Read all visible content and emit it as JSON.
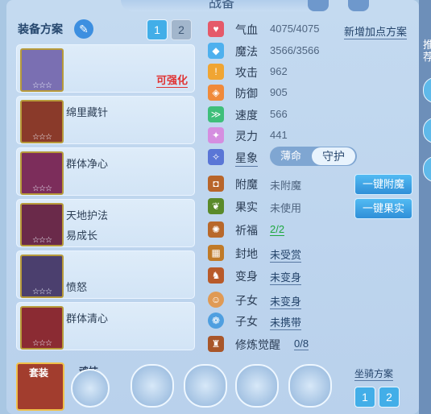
{
  "window": {
    "title": "战备"
  },
  "right_edge": {
    "text": "推荐"
  },
  "equip": {
    "label": "装备方案",
    "tabs": [
      "1",
      "2"
    ],
    "slots": [
      {
        "name": "",
        "stars": "☆☆☆",
        "tag": "可强化"
      },
      {
        "name": "绵里藏针",
        "stars": "☆☆☆"
      },
      {
        "name": "群体净心",
        "stars": "☆☆☆"
      },
      {
        "name": "天地护法",
        "sub": "易成长",
        "stars": "☆☆☆"
      },
      {
        "name": "愤怒",
        "stars": "☆☆☆"
      },
      {
        "name": "群体清心",
        "stars": "☆☆☆"
      }
    ]
  },
  "stats": {
    "add_scheme": "新增加点方案",
    "rows": [
      {
        "name": "气血",
        "value": "4075/4075"
      },
      {
        "name": "魔法",
        "value": "3566/3566"
      },
      {
        "name": "攻击",
        "value": "962"
      },
      {
        "name": "防御",
        "value": "905"
      },
      {
        "name": "速度",
        "value": "566"
      },
      {
        "name": "灵力",
        "value": "441"
      }
    ],
    "star_label": "星象",
    "star_options": [
      "薄命",
      "守护"
    ]
  },
  "extras": {
    "rows": [
      {
        "name": "附魔",
        "value": "未附魔"
      },
      {
        "name": "果实",
        "value": "未使用"
      },
      {
        "name": "祈福",
        "value": "2/2"
      },
      {
        "name": "封地",
        "value": "未受赏"
      },
      {
        "name": "变身",
        "value": "未变身"
      },
      {
        "name": "子女",
        "value": "未变身"
      },
      {
        "name": "子女",
        "value": "未携带"
      },
      {
        "name": "修炼觉醒",
        "value": "0/8"
      }
    ],
    "btn_enchant": "一键附魔",
    "btn_fruit": "一键果实"
  },
  "bottom": {
    "suit_label": "套装",
    "soul_label": "魂技",
    "mount_label": "坐骑方案",
    "mount_tabs": [
      "1",
      "2"
    ]
  }
}
